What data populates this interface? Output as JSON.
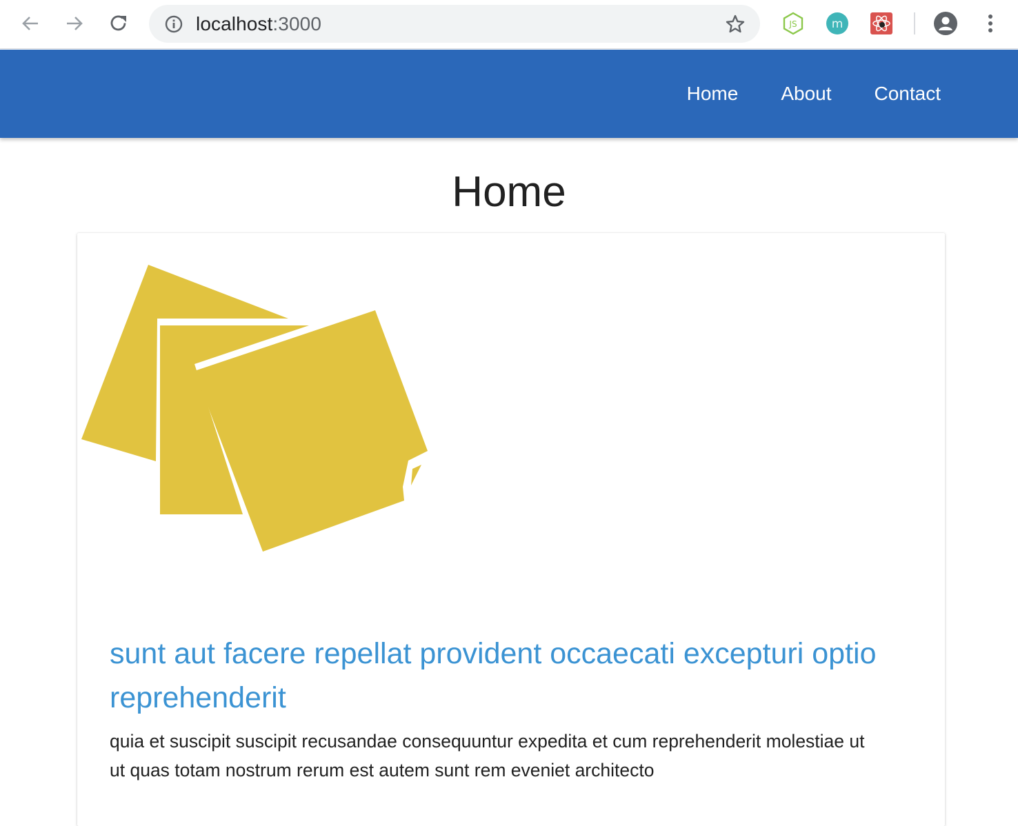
{
  "browser": {
    "url_host": "localhost",
    "url_port": ":3000",
    "extensions": [
      "node-js-icon",
      "m-extension-icon",
      "react-devtools-icon"
    ]
  },
  "nav": {
    "links": [
      "Home",
      "About",
      "Contact"
    ],
    "background": "#2b68b9"
  },
  "page": {
    "title": "Home"
  },
  "post": {
    "title": "sunt aut facere repellat provident occaecati excepturi optio reprehenderit",
    "body": "quia et suscipit suscipit recusandae consequuntur expedita et cum reprehenderit molestiae ut ut quas totam nostrum rerum est autem sunt rem eveniet architecto",
    "image_icon": "sticky-notes-icon",
    "image_color": "#e1c340",
    "title_color": "#3b93d3"
  }
}
